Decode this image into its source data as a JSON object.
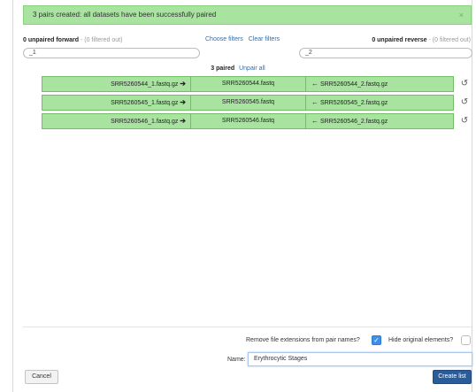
{
  "alert": {
    "message": "3 pairs created: all datasets have been successfully paired",
    "close_symbol": "×"
  },
  "forward": {
    "title": "0 unpaired forward",
    "filtered_note": "- (0 filtered out)",
    "filter_value": "_1"
  },
  "reverse": {
    "title": "0 unpaired reverse",
    "filtered_note": "- (0 filtered out)",
    "filter_value": "_2"
  },
  "filters": {
    "choose_label": "Choose filters",
    "clear_label": "Clear filters"
  },
  "paired": {
    "count_label": "3 paired",
    "unpair_all_label": "Unpair all"
  },
  "pairs": [
    {
      "forward": "SRR5260544_1.fastq.gz",
      "name": "SRR5260544.fastq",
      "reverse": "SRR5260544_2.fastq.gz"
    },
    {
      "forward": "SRR5260545_1.fastq.gz",
      "name": "SRR5260545.fastq",
      "reverse": "SRR5260545_2.fastq.gz"
    },
    {
      "forward": "SRR5260546_1.fastq.gz",
      "name": "SRR5260546.fastq",
      "reverse": "SRR5260546_2.fastq.gz"
    }
  ],
  "options": {
    "remove_extensions_label": "Remove file extensions from pair names?",
    "remove_extensions_checked": true,
    "hide_original_label": "Hide original elements?",
    "hide_original_checked": false
  },
  "name_field": {
    "label": "Name:",
    "value": "Erythrocytic Stages"
  },
  "buttons": {
    "cancel": "Cancel",
    "create": "Create list"
  },
  "icons": {
    "forward_arrow": "arrow-right-icon",
    "reverse_arrow": "arrow-left-icon",
    "unpair": "unlink-icon",
    "checkmark": "checkmark-icon"
  },
  "colors": {
    "pair_green": "#a8e4a0",
    "link_blue": "#2c6eb5",
    "primary_button": "#2b5c9a",
    "checkbox_blue": "#3d8fe8"
  }
}
